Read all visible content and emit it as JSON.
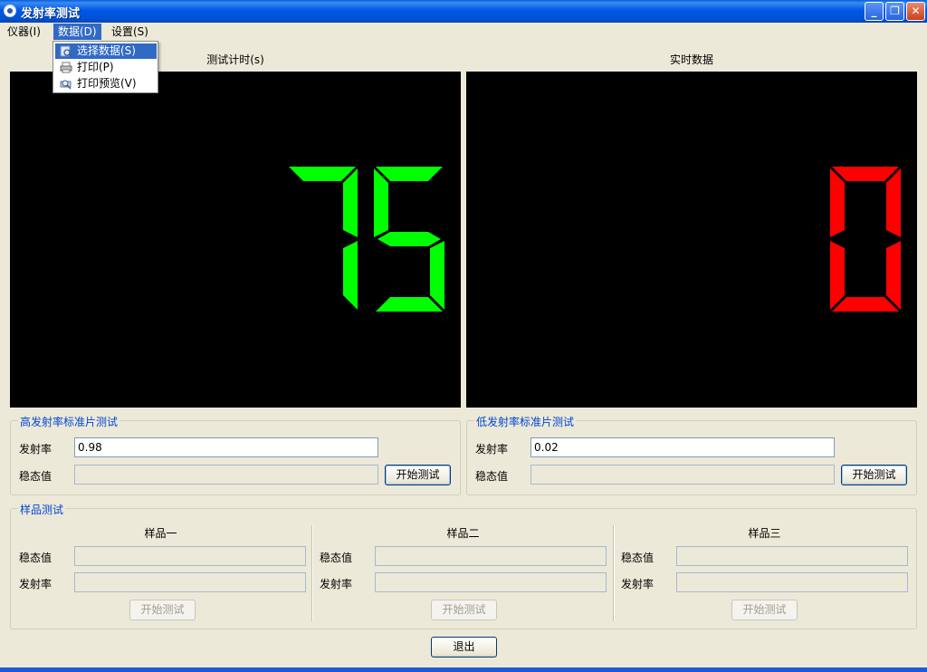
{
  "window": {
    "title": "发射率测试"
  },
  "menu": {
    "items": [
      "仪器(I)",
      "数据(D)",
      "设置(S)"
    ],
    "dropdown": [
      {
        "label": "选择数据(S)",
        "icon": "select-data-icon"
      },
      {
        "label": "打印(P)",
        "icon": "printer-icon"
      },
      {
        "label": "打印预览(V)",
        "icon": "print-preview-icon"
      }
    ]
  },
  "displays": {
    "timer_label": "测试计时(s)",
    "timer_value": "75",
    "timer_color": "#00ff00",
    "realtime_label": "实时数据",
    "realtime_value": "0",
    "realtime_color": "#ff0000"
  },
  "high_std": {
    "title": "高发射率标准片测试",
    "emissivity_label": "发射率",
    "emissivity_value": "0.98",
    "steady_label": "稳态值",
    "steady_value": "",
    "start_label": "开始测试"
  },
  "low_std": {
    "title": "低发射率标准片测试",
    "emissivity_label": "发射率",
    "emissivity_value": "0.02",
    "steady_label": "稳态值",
    "steady_value": "",
    "start_label": "开始测试"
  },
  "samples": {
    "title": "样品测试",
    "columns": [
      {
        "name": "样品一",
        "steady_label": "稳态值",
        "emissivity_label": "发射率",
        "start_label": "开始测试"
      },
      {
        "name": "样品二",
        "steady_label": "稳态值",
        "emissivity_label": "发射率",
        "start_label": "开始测试"
      },
      {
        "name": "样品三",
        "steady_label": "稳态值",
        "emissivity_label": "发射率",
        "start_label": "开始测试"
      }
    ]
  },
  "exit_label": "退出"
}
